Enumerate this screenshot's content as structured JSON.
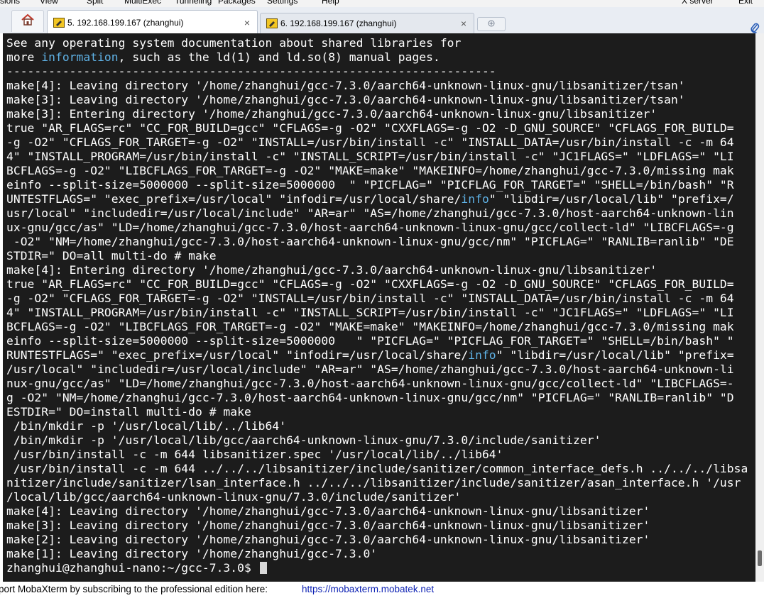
{
  "menubar": {
    "items": [
      "sions",
      "View",
      "Split",
      "MultiExec",
      "Tunneling",
      "Packages",
      "Settings",
      "Help",
      "X server",
      "Exit"
    ]
  },
  "tabs": [
    {
      "label": "5. 192.168.199.167 (zhanghui)",
      "active": true,
      "close": "×"
    },
    {
      "label": "6. 192.168.199.167 (zhanghui)",
      "active": false,
      "close": "×"
    }
  ],
  "icons": {
    "home": "home-icon",
    "session": "pen-terminal-icon",
    "new_tab": "new-tab-icon",
    "attach": "paperclip-icon"
  },
  "colors": {
    "terminal_bg": "#1c1c1c",
    "terminal_fg": "#ffffff",
    "highlight": "#5fb2e6",
    "link": "#0a1fb3"
  },
  "terminal": {
    "lines": [
      "See any operating system documentation about shared libraries for",
      "more information, such as the ld(1) and ld.so(8) manual pages.",
      "----------------------------------------------------------------------",
      "make[4]: Leaving directory '/home/zhanghui/gcc-7.3.0/aarch64-unknown-linux-gnu/libsanitizer/tsan'",
      "make[3]: Leaving directory '/home/zhanghui/gcc-7.3.0/aarch64-unknown-linux-gnu/libsanitizer/tsan'",
      "make[3]: Entering directory '/home/zhanghui/gcc-7.3.0/aarch64-unknown-linux-gnu/libsanitizer'",
      "true \"AR_FLAGS=rc\" \"CC_FOR_BUILD=gcc\" \"CFLAGS=-g -O2\" \"CXXFLAGS=-g -O2 -D_GNU_SOURCE\" \"CFLAGS_FOR_BUILD=",
      "-g -O2\" \"CFLAGS_FOR_TARGET=-g -O2\" \"INSTALL=/usr/bin/install -c\" \"INSTALL_DATA=/usr/bin/install -c -m 64",
      "4\" \"INSTALL_PROGRAM=/usr/bin/install -c\" \"INSTALL_SCRIPT=/usr/bin/install -c\" \"JC1FLAGS=\" \"LDFLAGS=\" \"LI",
      "BCFLAGS=-g -O2\" \"LIBCFLAGS_FOR_TARGET=-g -O2\" \"MAKE=make\" \"MAKEINFO=/home/zhanghui/gcc-7.3.0/missing mak",
      "einfo --split-size=5000000 --split-size=5000000  \" \"PICFLAG=\" \"PICFLAG_FOR_TARGET=\" \"SHELL=/bin/bash\" \"R",
      "UNTESTFLAGS=\" \"exec_prefix=/usr/local\" \"infodir=/usr/local/share/info\" \"libdir=/usr/local/lib\" \"prefix=/",
      "usr/local\" \"includedir=/usr/local/include\" \"AR=ar\" \"AS=/home/zhanghui/gcc-7.3.0/host-aarch64-unknown-lin",
      "ux-gnu/gcc/as\" \"LD=/home/zhanghui/gcc-7.3.0/host-aarch64-unknown-linux-gnu/gcc/collect-ld\" \"LIBCFLAGS=-g",
      " -O2\" \"NM=/home/zhanghui/gcc-7.3.0/host-aarch64-unknown-linux-gnu/gcc/nm\" \"PICFLAG=\" \"RANLIB=ranlib\" \"DE",
      "STDIR=\" DO=all multi-do # make",
      "make[4]: Entering directory '/home/zhanghui/gcc-7.3.0/aarch64-unknown-linux-gnu/libsanitizer'",
      "true \"AR_FLAGS=rc\" \"CC_FOR_BUILD=gcc\" \"CFLAGS=-g -O2\" \"CXXFLAGS=-g -O2 -D_GNU_SOURCE\" \"CFLAGS_FOR_BUILD=",
      "-g -O2\" \"CFLAGS_FOR_TARGET=-g -O2\" \"INSTALL=/usr/bin/install -c\" \"INSTALL_DATA=/usr/bin/install -c -m 64",
      "4\" \"INSTALL_PROGRAM=/usr/bin/install -c\" \"INSTALL_SCRIPT=/usr/bin/install -c\" \"JC1FLAGS=\" \"LDFLAGS=\" \"LI",
      "BCFLAGS=-g -O2\" \"LIBCFLAGS_FOR_TARGET=-g -O2\" \"MAKE=make\" \"MAKEINFO=/home/zhanghui/gcc-7.3.0/missing mak",
      "einfo --split-size=5000000 --split-size=5000000   \" \"PICFLAG=\" \"PICFLAG_FOR_TARGET=\" \"SHELL=/bin/bash\" \"",
      "RUNTESTFLAGS=\" \"exec_prefix=/usr/local\" \"infodir=/usr/local/share/info\" \"libdir=/usr/local/lib\" \"prefix=",
      "/usr/local\" \"includedir=/usr/local/include\" \"AR=ar\" \"AS=/home/zhanghui/gcc-7.3.0/host-aarch64-unknown-li",
      "nux-gnu/gcc/as\" \"LD=/home/zhanghui/gcc-7.3.0/host-aarch64-unknown-linux-gnu/gcc/collect-ld\" \"LIBCFLAGS=-",
      "g -O2\" \"NM=/home/zhanghui/gcc-7.3.0/host-aarch64-unknown-linux-gnu/gcc/nm\" \"PICFLAG=\" \"RANLIB=ranlib\" \"D",
      "ESTDIR=\" DO=install multi-do # make",
      " /bin/mkdir -p '/usr/local/lib/../lib64'",
      " /bin/mkdir -p '/usr/local/lib/gcc/aarch64-unknown-linux-gnu/7.3.0/include/sanitizer'",
      " /usr/bin/install -c -m 644 libsanitizer.spec '/usr/local/lib/../lib64'",
      " /usr/bin/install -c -m 644 ../../../libsanitizer/include/sanitizer/common_interface_defs.h ../../../libsa",
      "nitizer/include/sanitizer/lsan_interface.h ../../../libsanitizer/include/sanitizer/asan_interface.h '/usr",
      "/local/lib/gcc/aarch64-unknown-linux-gnu/7.3.0/include/sanitizer'",
      "make[4]: Leaving directory '/home/zhanghui/gcc-7.3.0/aarch64-unknown-linux-gnu/libsanitizer'",
      "make[3]: Leaving directory '/home/zhanghui/gcc-7.3.0/aarch64-unknown-linux-gnu/libsanitizer'",
      "make[2]: Leaving directory '/home/zhanghui/gcc-7.3.0/aarch64-unknown-linux-gnu/libsanitizer'",
      "make[1]: Leaving directory '/home/zhanghui/gcc-7.3.0'"
    ],
    "highlight_word": "info",
    "prompt": "zhanghui@zhanghui-nano:~/gcc-7.3.0$ "
  },
  "statusbar": {
    "text": "port MobaXterm by subscribing to the professional edition here:",
    "link": "https://mobaxterm.mobatek.net"
  }
}
